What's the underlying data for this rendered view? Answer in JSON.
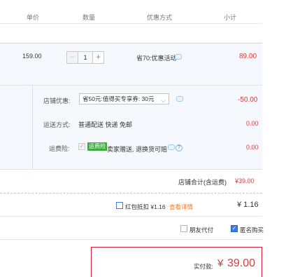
{
  "header": {
    "col_price": "单价",
    "col_qty": "数量",
    "col_promo": "优惠方式",
    "col_subtotal": "小计"
  },
  "item": {
    "unit_price": "159.00",
    "qty_minus": "−",
    "qty_value": "1",
    "qty_plus": "+",
    "promo_text": "省70:优惠活动",
    "subtotal": "89.00"
  },
  "shop": {
    "discount_label": "店铺优惠:",
    "discount_select": "省50元:值得买专享券: 30元",
    "discount_amount": "-50.00",
    "shipping_label": "运送方式:",
    "shipping_value": "普通配送 快递 免邮",
    "shipping_amount": "0.00",
    "insurance_label": "运费险:",
    "insurance_tag": "运费险",
    "insurance_text": "卖家赠送, 退换货可赔",
    "insurance_amount": "0.00",
    "total_label": "店铺合计(含运费)",
    "total_value": "¥39.00"
  },
  "redpacket": {
    "label": "红包抵扣 ¥1.16",
    "details_link": "查看详情",
    "amount": "¥ 1.16"
  },
  "options": {
    "friend_pay": "朋友代付",
    "anonymous": "匿名购买"
  },
  "payment": {
    "label": "实付款:",
    "currency": "¥",
    "amount": "39.00"
  },
  "colors": {
    "accent_red": "#e4393c",
    "link_orange": "#f07b2b",
    "tag_green": "#3eab3e",
    "row_bg": "#f5f9fd"
  }
}
